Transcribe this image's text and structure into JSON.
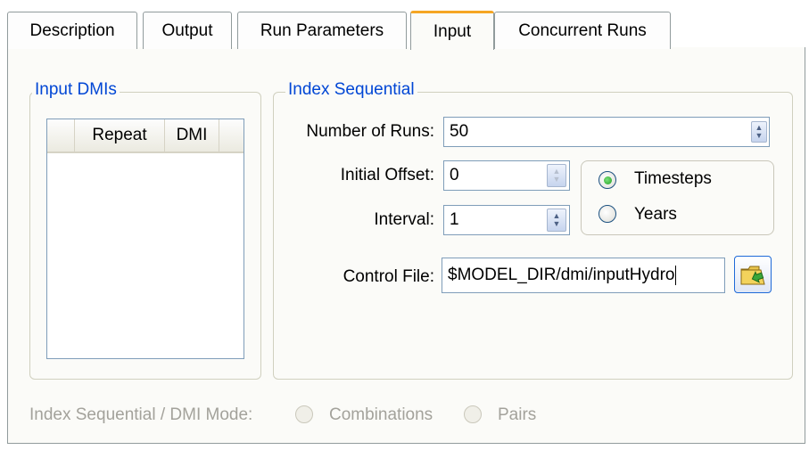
{
  "tabs": [
    {
      "label": "Description"
    },
    {
      "label": "Output"
    },
    {
      "label": "Run Parameters"
    },
    {
      "label": "Input"
    },
    {
      "label": "Concurrent Runs"
    }
  ],
  "input_dmis": {
    "title": "Input DMIs",
    "columns": [
      "Repeat",
      "DMI"
    ]
  },
  "index_sequential": {
    "title": "Index Sequential",
    "number_of_runs_label": "Number of Runs:",
    "number_of_runs_value": "50",
    "initial_offset_label": "Initial Offset:",
    "initial_offset_value": "0",
    "interval_label": "Interval:",
    "interval_value": "1",
    "units": {
      "timesteps_label": "Timesteps",
      "years_label": "Years",
      "selected": "Timesteps"
    },
    "control_file_label": "Control File:",
    "control_file_value": "$MODEL_DIR/dmi/inputHydro"
  },
  "mode": {
    "label": "Index Sequential / DMI Mode:",
    "combinations_label": "Combinations",
    "pairs_label": "Pairs"
  }
}
